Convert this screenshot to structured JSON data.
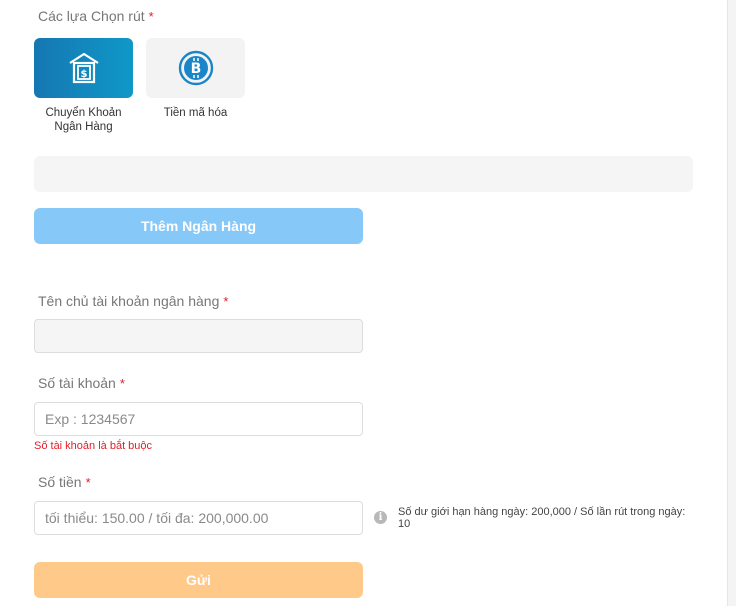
{
  "withdraw_options": {
    "label": "Các lựa Chọn rút",
    "required_mark": "*",
    "items": [
      {
        "label": "Chuyển Khoản Ngân Hàng",
        "icon": "bank-transfer-icon",
        "selected": true
      },
      {
        "label": "Tiền mã hóa",
        "icon": "bitcoin-icon",
        "selected": false
      }
    ]
  },
  "add_bank_button": {
    "label": "Thêm Ngân Hàng"
  },
  "account_holder": {
    "label": "Tên chủ tài khoản ngân hàng",
    "required_mark": "*",
    "value": ""
  },
  "account_number": {
    "label": "Số tài khoản",
    "required_mark": "*",
    "placeholder": "Exp : 1234567",
    "error": "Số tài khoản là bắt buộc"
  },
  "amount": {
    "label": "Số tiền",
    "required_mark": "*",
    "placeholder": "tối thiểu: 150.00 / tối đa: 200,000.00",
    "info": "Số dư giới hạn hàng ngày: 200,000 / Số lần rút trong ngày: 10"
  },
  "submit_button": {
    "label": "Gửi"
  },
  "colors": {
    "accent_blue": "#1677b2",
    "add_button": "#86c8f8",
    "submit_button": "#ffc98a",
    "error": "#e0202a"
  }
}
